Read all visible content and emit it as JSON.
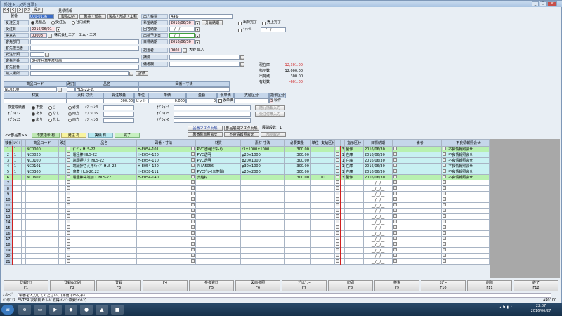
{
  "window": {
    "title": "受注入力(受注票)"
  },
  "nav": {
    "prev2": "<<",
    "prev": "<",
    "next": ">",
    "next2": ">>",
    "settings": "設定"
  },
  "header": {
    "mitsumori_label": "見積情報",
    "mitsumori_btn1": "製品のみ",
    "mitsumori_btn2": "製品・部品",
    "mitsumori_btn3": "製品・部品・工程",
    "seiban_label": "製番",
    "seiban_value": "000-0136",
    "jukubun_label": "受注区分",
    "jukubun_opts": [
      "見積品",
      "受注品",
      "社内消費"
    ],
    "jubi_label": "受注日",
    "jubi_value": "2016/06/01",
    "tokui_label": "得意先",
    "tokui_code": "00008",
    "tokui_name": "株式会社エア・エム・エス",
    "kyakusaki_bumon_label": "客先部門",
    "kyakusaki_tanto_label": "客先担当者",
    "jubunrui_label": "受注分類",
    "kyaku_chuban_label": "客先注番",
    "kyaku_chuban_value": "8月度月車生産計画",
    "kyaku_seiban_label": "客先製番",
    "nonyu_label": "納入場所",
    "detail_btn": "詳細",
    "shutsuryoku_label": "出力帳票",
    "shutsuryoku_value": "A4縦",
    "kibou_label": "希望納期",
    "kibou_value": "2016/06/30",
    "kibou_btn": "分納納期",
    "kaito_label": "回答納期",
    "kaito_value": "__/__/__",
    "shukka_label": "出荷予定日",
    "shukka_value": "__/__/__",
    "mokuhyo_label": "目標納期",
    "mokuhyo_value": "2016/06/30",
    "tanto_label": "担当者",
    "tanto_code": "0001",
    "tanto_name": "大野 成人",
    "tekiyo_label": "摘要",
    "biko_label": "備考欄",
    "chk1": "出荷完了",
    "chk2": "売上完了",
    "chk3": "ｷｬﾝｾﾙ",
    "cancel_date": "__/__/__"
  },
  "stock": {
    "genzaiko_label": "現在庫",
    "genzaiko_value": "-12,301.00",
    "shijisu_label": "指示数",
    "shijisu_value": "12,000.00",
    "shukkasu_label": "出荷残",
    "shukkasu_value": "300.00",
    "yuko_label": "有効数",
    "yuko_value": "-601.00"
  },
  "product": {
    "code_label": "商品コード",
    "kaihan_label": "改訂",
    "name_label": "品名",
    "zuban_label": "図番・寸法",
    "code_value": "NC0200",
    "name_value": "HLS-22-式",
    "zairyo_label": "材質",
    "sozai_label": "素材 寸法",
    "juchusu_label": "受注数量",
    "tani_label": "単位",
    "tanka_label": "単価",
    "kingaku_label": "金額",
    "kyo_label": "仮単価",
    "shikyu_label": "支給区分",
    "shiji_label": "指示区分",
    "juchusu_value": "300.00",
    "tani_value": "セット",
    "tanka_value": "0.000",
    "kingaku_value": "0",
    "kyo_value": "仮単価",
    "shiji_code": "3",
    "shiji_name": "製作",
    "kensa_label": "検査成績書",
    "kensa_opts": [
      "不要",
      "○",
      "必要"
    ],
    "opt2_label": "ｵﾌﾟｼｮﾝ2",
    "opt2_opts": [
      "あり",
      "なし",
      "両方"
    ],
    "opt3_label": "ｵﾌﾟｼｮﾝ3",
    "opt3_opts": [
      "あり",
      "なし",
      "両方"
    ],
    "opt4_label": "ｵﾌﾟｼｮﾝ4",
    "opt5_label": "ｵﾌﾟｼｮﾝ5",
    "opt6_label": "ｵﾌﾟｼｮﾝ6",
    "btn_tsuika": "随行情報入力",
    "btn_juchu": "受注付帯入力"
  },
  "parts": {
    "section_label": "<<部品表>>",
    "legend": [
      "作業指示 有",
      "発注 有",
      "実績 有",
      "完了"
    ],
    "btn_master": "品番マスタ反映",
    "btn_tejun": "部品展開マスタ反映",
    "tenkai_label": "展開段数：1",
    "btn_seizo": "製番別表照会せ",
    "btn_futekiai": "不良情報照会せ",
    "btn_buhin": "部品取込",
    "columns": [
      "枝番",
      "ﾚﾍﾞﾙ",
      "",
      "商品コード",
      "改訂",
      "",
      "品名",
      "図番・寸法",
      "材質",
      "素材 寸法",
      "必要数量",
      "単位",
      "支給区分",
      "",
      "指示区分",
      "",
      "目標納期",
      "",
      "備考",
      "",
      "不良情報照会せ"
    ],
    "rows": [
      {
        "no": "1",
        "lvl": "1",
        "code": "NC0000",
        "name": "ﾎﾞﾃﾞｨ HLS-22",
        "zuban": "H-E054-101",
        "zairyo": "PVC透明(ﾗﾐﾈｰﾄ)",
        "sunpo": "t3×1000×1000",
        "qty": "300.00",
        "tani": "",
        "shikyu": "",
        "shiji_c": "3",
        "shiji": "製作",
        "date": "2016/06/30",
        "biko": "",
        "fb": "不良情報照会せ"
      },
      {
        "no": "2",
        "lvl": "1",
        "code": "NC0020",
        "name": "電極棒 HLS-22",
        "zuban": "H-E054-120",
        "zairyo": "PVC透明",
        "sunpo": "φ20×1000",
        "qty": "300.00",
        "tani": "",
        "shikyu": "",
        "shiji_c": "1",
        "shiji": "在庫",
        "date": "2016/06/30",
        "biko": "",
        "fb": "不良情報照会せ"
      },
      {
        "no": "3",
        "lvl": "1",
        "code": "NC0100",
        "name": "端頭押さえ HLS-22",
        "zuban": "H-E054-110",
        "zairyo": "PVC透明",
        "sunpo": "φ20×1000",
        "qty": "300.00",
        "tani": "",
        "shikyu": "",
        "shiji_c": "1",
        "shiji": "在庫",
        "date": "2016/06/30",
        "biko": "",
        "fb": "不良情報照会せ"
      },
      {
        "no": "4",
        "lvl": "1",
        "code": "NC0101",
        "name": "端頭押さえ用ｷｬｯﾌﾟ HLS-22",
        "zuban": "H-E054-120",
        "zairyo": "ｱﾙﾐA5056",
        "sunpo": "φ30×1000",
        "qty": "300.00",
        "tani": "",
        "shikyu": "",
        "shiji_c": "1",
        "shiji": "在庫",
        "date": "2016/06/30",
        "biko": "",
        "fb": "不良情報照会せ"
      },
      {
        "no": "5",
        "lvl": "1",
        "code": "NC0300",
        "name": "底蓋 HLS-20,22",
        "zuban": "H-E038-111",
        "zairyo": "PVCｸﾞﾚｰ(三菱製)",
        "sunpo": "φ20×2000",
        "qty": "300.00",
        "tani": "",
        "shikyu": "",
        "shiji_c": "1",
        "shiji": "在庫",
        "date": "2016/06/30",
        "biko": "",
        "fb": "不良情報照会せ"
      },
      {
        "no": "6",
        "lvl": "1",
        "code": "NC0602",
        "name": "電極棒先端加工 HLS-22",
        "zuban": "H-E054-140",
        "zairyo": "支給材",
        "sunpo": "",
        "qty": "300.00",
        "tani": "",
        "shikyu": "01",
        "shiji_c": "3",
        "shiji": "製作",
        "date": "2016/06/30",
        "biko": "",
        "fb": "不良情報照会せ",
        "extra": "材料支給"
      },
      {
        "no": "7"
      },
      {
        "no": "8"
      },
      {
        "no": "9"
      },
      {
        "no": "10"
      },
      {
        "no": "11"
      },
      {
        "no": "12"
      },
      {
        "no": "13"
      },
      {
        "no": "14"
      },
      {
        "no": "15"
      },
      {
        "no": "16"
      },
      {
        "no": "17"
      },
      {
        "no": "18"
      },
      {
        "no": "19"
      },
      {
        "no": "20"
      },
      {
        "no": "21"
      }
    ]
  },
  "fkeys": [
    {
      "l1": "登録ｸﾘｱ",
      "l2": "F1"
    },
    {
      "l1": "登録&印刷",
      "l2": "F2"
    },
    {
      "l1": "登録",
      "l2": "F3"
    },
    {
      "l1": "",
      "l2": "F4"
    },
    {
      "l1": "参考資料",
      "l2": "F5"
    },
    {
      "l1": "図面参照",
      "l2": "F6"
    },
    {
      "l1": "ﾌﾟﾚﾋﾞｭｰ",
      "l2": "F7"
    },
    {
      "l1": "印刷",
      "l2": "F8"
    },
    {
      "l1": "検索",
      "l2": "F9"
    },
    {
      "l1": "ｺﾋﾟｰ",
      "l2": "F10"
    },
    {
      "l1": "削除",
      "l2": "F11"
    },
    {
      "l1": "終了",
      "l2": "F12"
    }
  ],
  "status": {
    "msg_label": "ﾒｯｾｰｼﾞ",
    "msg": "製番を入力してください。(半角)(15文字)",
    "guide_label": "ｶﾞｲﾀﾞﾝｽ",
    "guide": "ENTER:次項目 6:ｺｰﾄﾞ取得 ｲｰｼﾞ:検索ｳｲﾝﾄﾞｳ",
    "code": "AP0100"
  },
  "taskbar": {
    "time": "22:07",
    "date": "2016/06/27"
  }
}
